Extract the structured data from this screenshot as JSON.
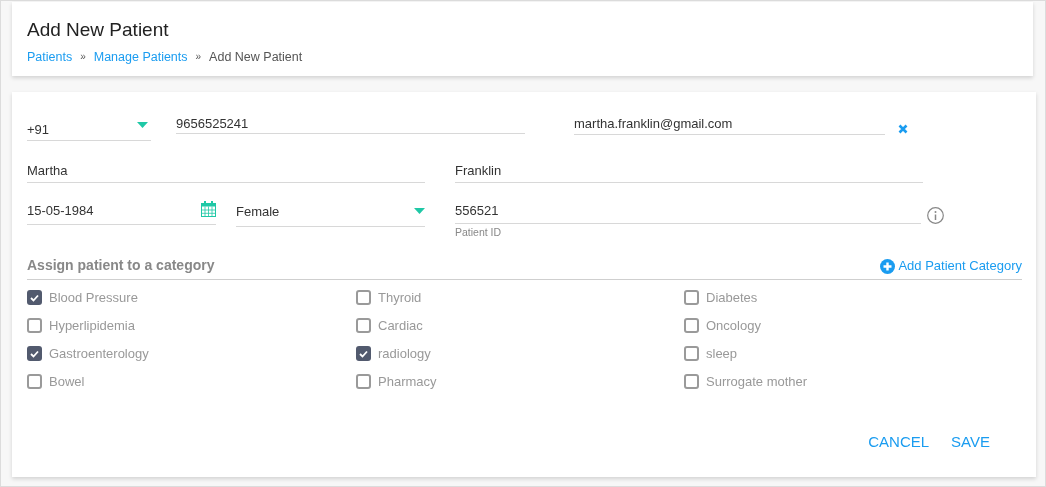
{
  "header": {
    "title": "Add New Patient",
    "breadcrumb_separator": "»",
    "breadcrumb": [
      {
        "label": "Patients",
        "kind": "link"
      },
      {
        "label": "Manage Patients",
        "kind": "link"
      },
      {
        "label": "Add New Patient",
        "kind": "current"
      }
    ]
  },
  "form": {
    "country_code": "+91",
    "phone": "9656525241",
    "email": "martha.franklin@gmail.com",
    "first_name": "Martha",
    "last_name": "Franklin",
    "dob": "15-05-1984",
    "gender": "Female",
    "patient_id": "556521",
    "patient_id_helper": "Patient ID"
  },
  "categories": {
    "title": "Assign patient to a category",
    "add_link": "Add Patient Category",
    "items": [
      {
        "label": "Blood Pressure",
        "checked": true
      },
      {
        "label": "Thyroid",
        "checked": false
      },
      {
        "label": "Diabetes",
        "checked": false
      },
      {
        "label": "Hyperlipidemia",
        "checked": false
      },
      {
        "label": "Cardiac",
        "checked": false
      },
      {
        "label": "Oncology",
        "checked": false
      },
      {
        "label": "Gastroenterology",
        "checked": true
      },
      {
        "label": "radiology",
        "checked": true
      },
      {
        "label": "sleep",
        "checked": false
      },
      {
        "label": "Bowel",
        "checked": false
      },
      {
        "label": "Pharmacy",
        "checked": false
      },
      {
        "label": "Surrogate mother",
        "checked": false
      }
    ]
  },
  "buttons": [
    "CANCEL",
    "SAVE"
  ]
}
